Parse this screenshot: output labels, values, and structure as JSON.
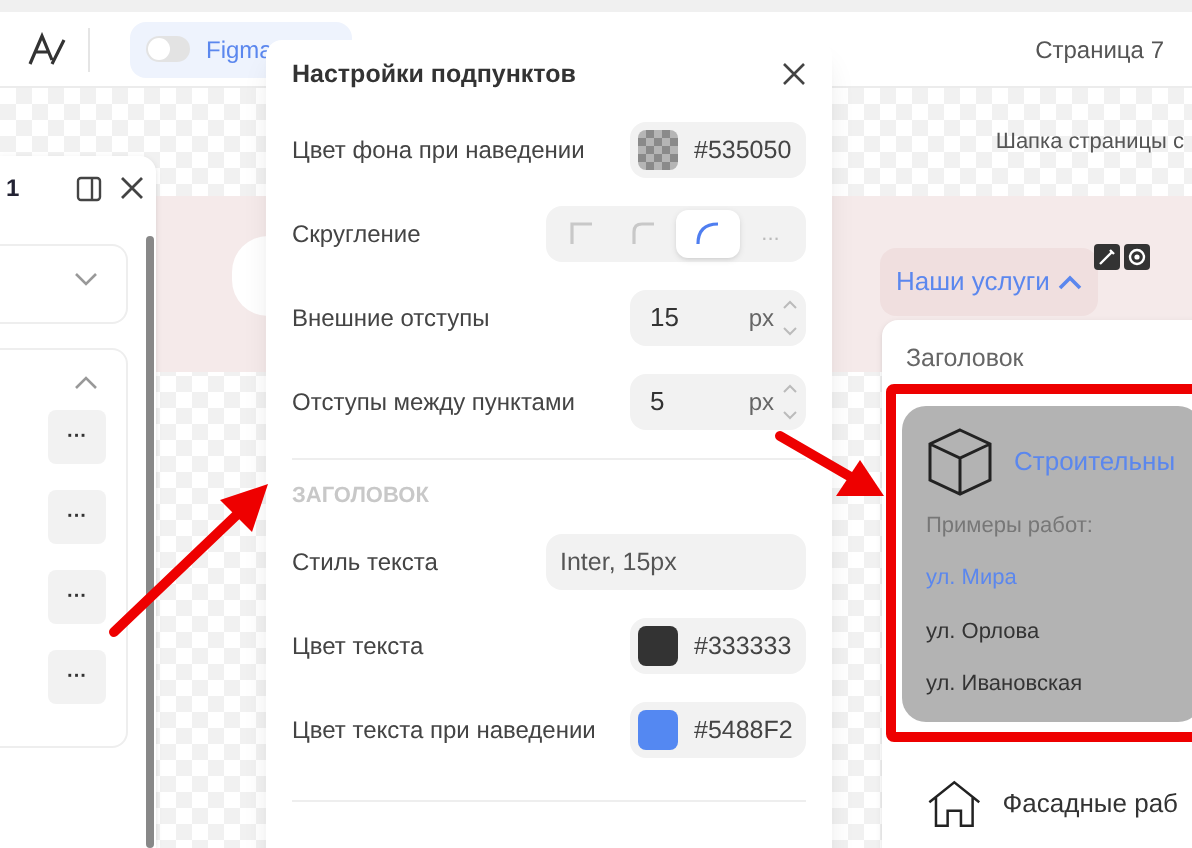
{
  "toolbar": {
    "toggle": {
      "label": "Figma",
      "on": false
    },
    "page_label": "Страница 7"
  },
  "layers_panel": {
    "title": "1",
    "sections": [
      {
        "expanded": false
      },
      {
        "expanded": true,
        "buttons": [
          "···",
          "···",
          "···",
          "···"
        ]
      }
    ]
  },
  "canvas": {
    "header_caption": "Шапка страницы с",
    "menu_button": {
      "label": "Наши услуги",
      "expanded": true
    },
    "dropdown": {
      "heading": "Заголовок",
      "items": [
        {
          "kind": "cube",
          "title": "Строительны",
          "highlighted": true,
          "examples_label": "Примеры работ:",
          "links": [
            {
              "label": "ул. Мира",
              "selected": true
            },
            {
              "label": "ул. Орлова",
              "selected": false
            },
            {
              "label": "ул. Ивановская",
              "selected": false
            }
          ]
        },
        {
          "kind": "house",
          "title": "Фасадные раб",
          "highlighted": false
        }
      ]
    }
  },
  "dialog": {
    "title": "Настройки подпунктов",
    "sections": [
      {
        "rows": [
          {
            "kind": "color",
            "label": "Цвет фона при наведении",
            "value": "#535050",
            "transparent": true
          },
          {
            "kind": "segments",
            "label": "Скругление",
            "options": [
              {
                "kind": "sharp",
                "selected": false
              },
              {
                "kind": "small",
                "selected": false
              },
              {
                "kind": "round",
                "selected": true
              },
              {
                "kind": "more",
                "label": "...",
                "selected": false
              }
            ]
          },
          {
            "kind": "number",
            "label": "Внешние отступы",
            "value": "15",
            "unit": "px"
          },
          {
            "kind": "number",
            "label": "Отступы между пунктами",
            "value": "5",
            "unit": "px"
          }
        ]
      },
      {
        "heading": "ЗАГОЛОВОК",
        "rows": [
          {
            "kind": "text",
            "label": "Стиль текста",
            "value": "Inter, 15px"
          },
          {
            "kind": "color",
            "label": "Цвет текста",
            "value": "#333333",
            "transparent": false
          },
          {
            "kind": "color",
            "label": "Цвет текста при наведении",
            "value": "#5488F2",
            "transparent": false
          }
        ]
      }
    ]
  }
}
